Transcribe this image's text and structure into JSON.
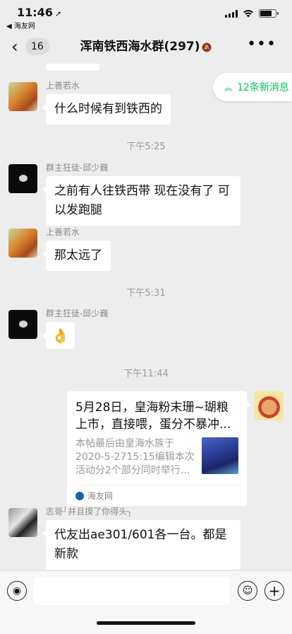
{
  "status": {
    "time": "11:46",
    "back_app": "◀ 海友网",
    "battery_level": 0.75
  },
  "nav": {
    "back_icon": "chevron-left-icon",
    "unread_count": "16",
    "title": "浑南铁西海水群(297)",
    "more_label": "•••"
  },
  "new_messages": {
    "label": "12条新消息"
  },
  "messages": [
    {
      "sender": "上善若水",
      "text": "什么时候有到铁西的"
    },
    {
      "sender": "群主狂徒-邱少巍",
      "text": "之前有人往铁西带 现在没有了 可以发跑腿"
    },
    {
      "sender": "上善若水",
      "text": "那太远了"
    },
    {
      "sender": "群主狂徒-邱少巍",
      "text": "👌"
    },
    {
      "sender": "志哥╯并且摸了你得头╮",
      "text": "代友出ae301/601各一台。都是新款"
    }
  ],
  "timestamps": [
    "下午5:25",
    "下午5:31",
    "下午11:44"
  ],
  "link_card": {
    "title": "5月28日，皇海粉末珊~瑚粮上市，直接喂，蛋分不暴冲...",
    "description": "本帖最后由皇海水族于2020-5-2715:15编辑本次活动分2个部分同时举行...",
    "source": "海友网"
  },
  "input": {
    "placeholder": ""
  },
  "colors": {
    "accent": "#07c160",
    "background": "#ededed"
  }
}
